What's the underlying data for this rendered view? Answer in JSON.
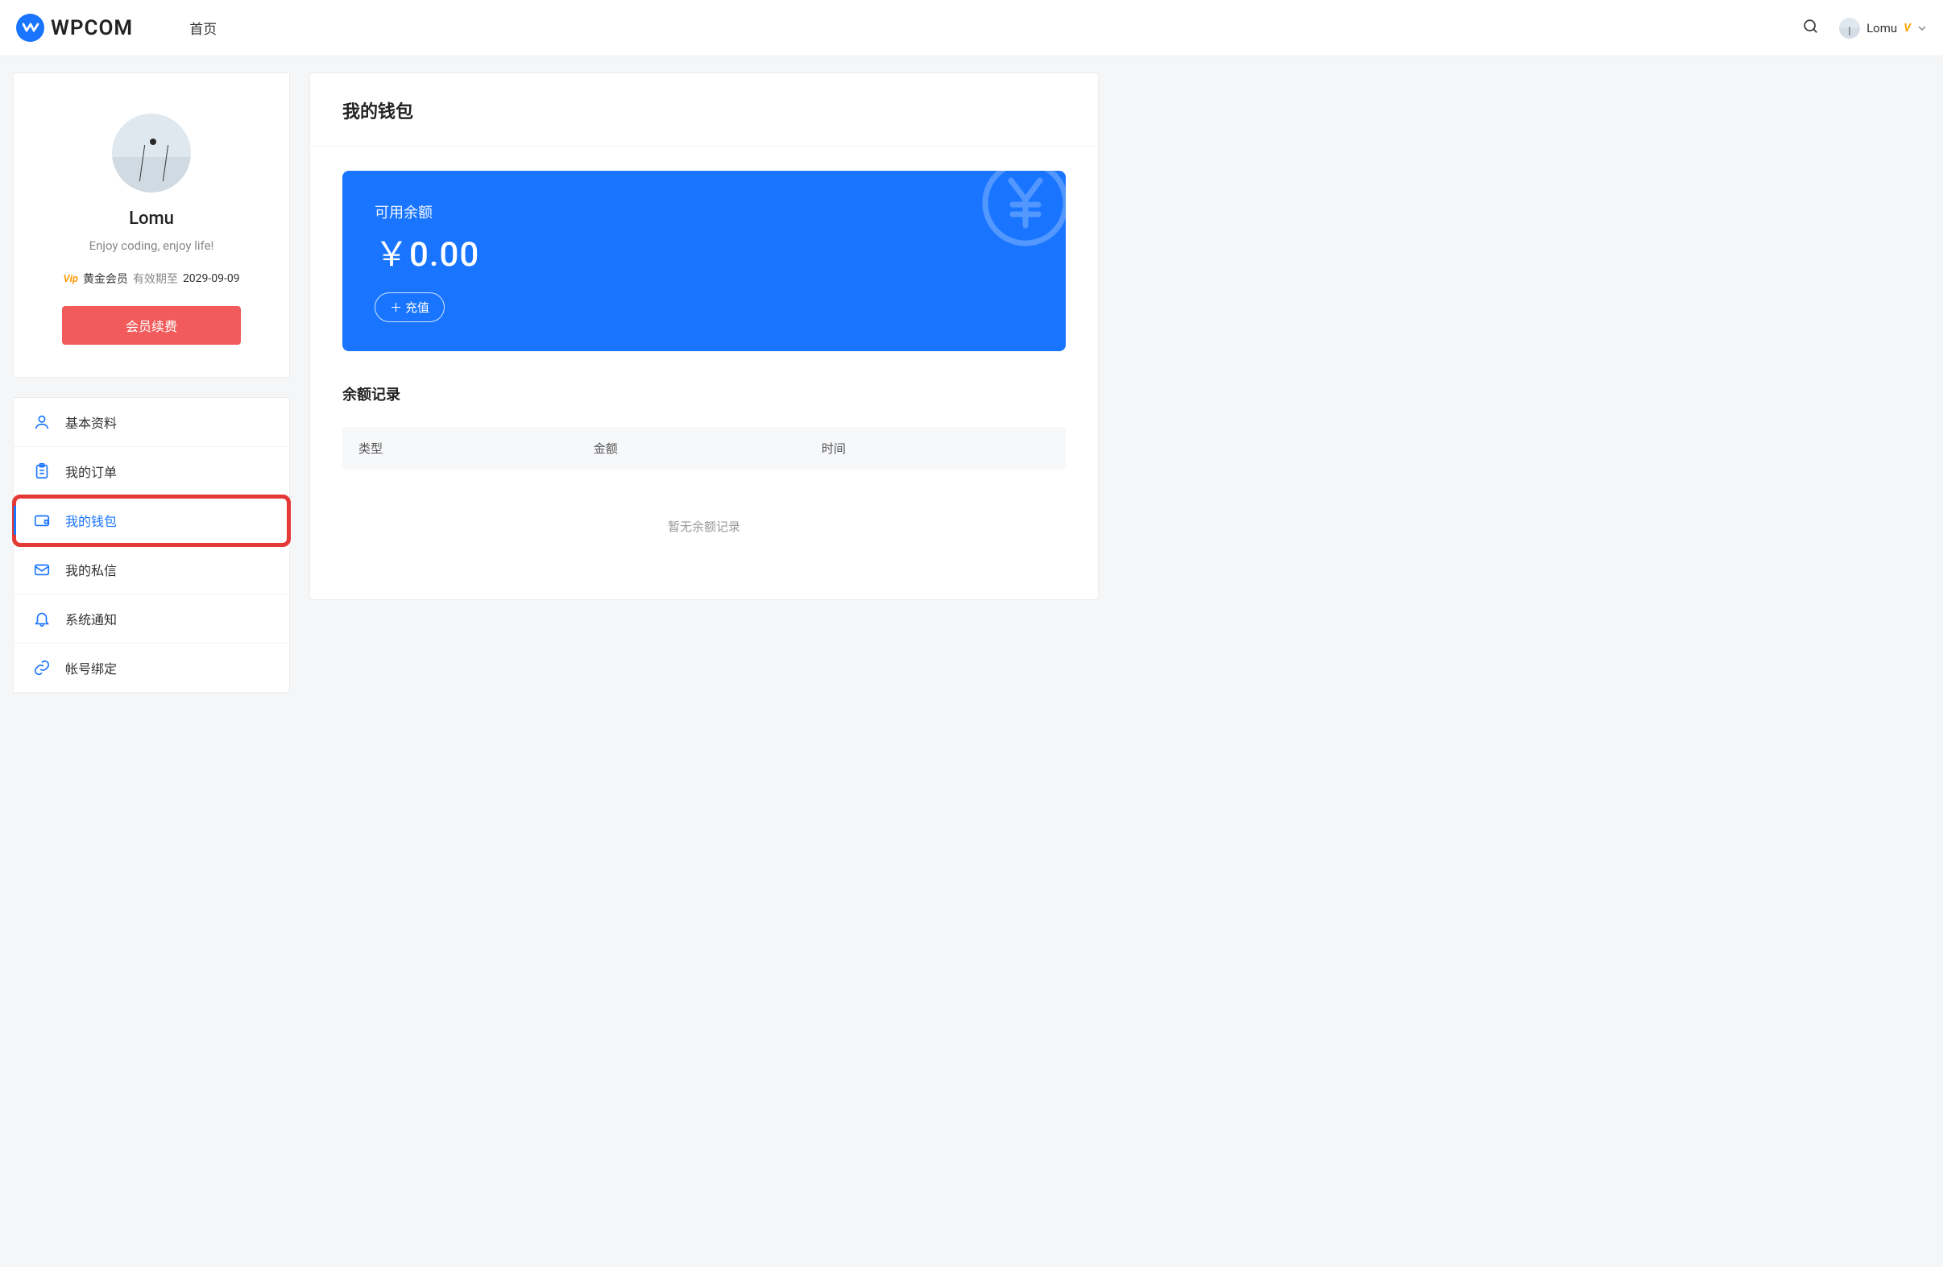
{
  "header": {
    "brand": "WPCOM",
    "nav_home": "首页",
    "user_name": "Lomu"
  },
  "profile": {
    "name": "Lomu",
    "bio": "Enjoy coding, enjoy life!",
    "vip_label": "Vip",
    "member_type": "黄金会员",
    "expiry_prefix": "有效期至",
    "expiry_date": "2029-09-09",
    "renew_button": "会员续费"
  },
  "menu": {
    "items": [
      {
        "label": "基本资料"
      },
      {
        "label": "我的订单"
      },
      {
        "label": "我的钱包"
      },
      {
        "label": "我的私信"
      },
      {
        "label": "系统通知"
      },
      {
        "label": "帐号绑定"
      }
    ]
  },
  "wallet": {
    "page_title": "我的钱包",
    "balance_label": "可用余额",
    "balance_amount": "￥0.00",
    "recharge_button": "充值",
    "records_title": "余额记录",
    "col_type": "类型",
    "col_amount": "金额",
    "col_time": "时间",
    "no_records": "暂无余额记录"
  }
}
